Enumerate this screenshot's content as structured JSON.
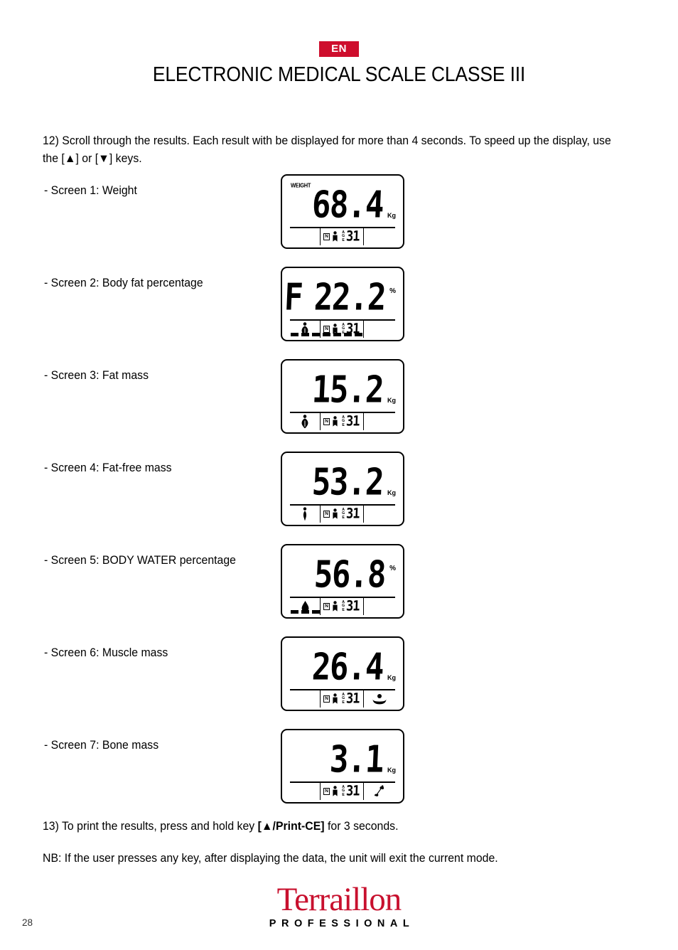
{
  "header": {
    "language_badge": "EN",
    "title": "ELECTRONIC MEDICAL SCALE CLASSE III",
    "badge_color": "#ce0e2d"
  },
  "intro": {
    "text": "12) Scroll through the results. Each result with be displayed for more than 4 seconds. To speed up the display, use the [▲] or [▼] keys."
  },
  "screens": [
    {
      "label": "- Screen 1: Weight",
      "weight_tag": "WEIGHT",
      "prefix": "",
      "value": "68.4",
      "unit": "Kg",
      "left_icon": "",
      "right_icon": "",
      "n_marker": "N",
      "age_label": "AGE",
      "age_value": "31",
      "dashes": 0
    },
    {
      "label": "- Screen 2: Body fat percentage",
      "weight_tag": "",
      "prefix": "F",
      "value": "22.2",
      "unit": "%",
      "left_icon": "body-fat-icon",
      "right_icon": "",
      "n_marker": "N",
      "age_label": "AGE",
      "age_value": "31",
      "dashes": 7
    },
    {
      "label": "- Screen 3: Fat mass",
      "weight_tag": "",
      "prefix": "",
      "value": "15.2",
      "unit": "Kg",
      "left_icon": "body-fat-icon",
      "right_icon": "",
      "n_marker": "N",
      "age_label": "AGE",
      "age_value": "31",
      "dashes": 0
    },
    {
      "label": "- Screen 4: Fat-free mass",
      "weight_tag": "",
      "prefix": "",
      "value": "53.2",
      "unit": "Kg",
      "left_icon": "lean-body-icon",
      "right_icon": "",
      "n_marker": "N",
      "age_label": "AGE",
      "age_value": "31",
      "dashes": 0
    },
    {
      "label": "- Screen 5: BODY WATER percentage",
      "weight_tag": "",
      "prefix": "",
      "value": "56.8",
      "unit": "%",
      "left_icon": "water-drop-icon",
      "right_icon": "",
      "n_marker": "N",
      "age_label": "AGE",
      "age_value": "31",
      "dashes": 3
    },
    {
      "label": "- Screen 6: Muscle mass",
      "weight_tag": "",
      "prefix": "",
      "value": "26.4",
      "unit": "Kg",
      "left_icon": "",
      "right_icon": "muscle-icon",
      "n_marker": "N",
      "age_label": "AGE",
      "age_value": "31",
      "dashes": 0
    },
    {
      "label": "- Screen 7: Bone mass",
      "weight_tag": "",
      "prefix": "",
      "value": "3.1",
      "unit": "Kg",
      "left_icon": "",
      "right_icon": "bone-icon",
      "n_marker": "N",
      "age_label": "AGE",
      "age_value": "31",
      "dashes": 0
    }
  ],
  "footer_notes": {
    "print_prefix": "13) To print the results, press and hold key ",
    "print_key": "[▲/Print-CE]",
    "print_suffix": " for 3 seconds.",
    "nb_note": "NB: If the user presses any key, after displaying the data, the unit will exit the current mode."
  },
  "brand": {
    "name": "Terraillon",
    "subtitle": "PROFESSIONAL",
    "color": "#c8102e"
  },
  "page_number": "28"
}
